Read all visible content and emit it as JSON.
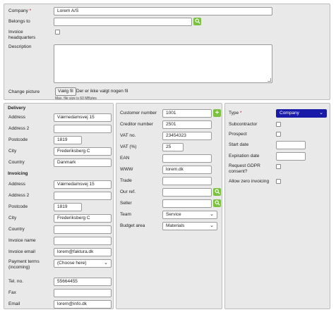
{
  "top": {
    "company_label": "Company",
    "required_mark": "*",
    "company_value": "Lorem A/S",
    "belongs_to_label": "Belongs to",
    "belongs_to_value": "",
    "invoice_hq_label": "Invoice headquarters",
    "description_label": "Description",
    "change_picture_label": "Change picture",
    "file_button_label": "Vælg fil",
    "file_status": "Der er ikke valgt nogen fil",
    "file_hint": "Max. file size is 60 MBytes"
  },
  "delivery": {
    "title": "Delivery",
    "address_label": "Address",
    "address_value": "Værnedamsvej 15",
    "address2_label": "Address 2",
    "address2_value": "",
    "postcode_label": "Postcode",
    "postcode_value": "1819",
    "city_label": "City",
    "city_value": "Frederiksberg C",
    "country_label": "Country",
    "country_value": "Danmark"
  },
  "invoicing": {
    "title": "Invoicing",
    "address_label": "Address",
    "address_value": "Værnedamsvej 15",
    "address2_label": "Address 2",
    "address2_value": "",
    "postcode_label": "Postcode",
    "postcode_value": "1819",
    "city_label": "City",
    "city_value": "Frederiksberg C",
    "country_label": "Country",
    "country_value": "",
    "invoice_name_label": "Invoice name",
    "invoice_name_value": "",
    "invoice_email_label": "Invoice email",
    "invoice_email_value": "lorem@faktura.dk",
    "payment_terms_label": "Payment terms (incoming)",
    "payment_terms_value": "(Choose here)",
    "tel_label": "Tel. no.",
    "tel_value": "55664455",
    "fax_label": "Fax",
    "fax_value": "",
    "email_label": "Email",
    "email_value": "lorem@info.dk"
  },
  "middle": {
    "customer_number_label": "Customer number",
    "customer_number_value": "1001",
    "creditor_number_label": "Creditor number",
    "creditor_number_value": "2501",
    "vat_no_label": "VAT no.",
    "vat_no_value": "23454323",
    "vat_pct_label": "VAT (%)",
    "vat_pct_value": "25",
    "ean_label": "EAN",
    "ean_value": "",
    "www_label": "WWW",
    "www_value": "lorem.dk",
    "trade_label": "Trade",
    "trade_value": "",
    "our_ref_label": "Our ref.",
    "our_ref_value": "",
    "seller_label": "Seller",
    "seller_value": "",
    "team_label": "Team",
    "team_value": "Service",
    "budget_area_label": "Budget area",
    "budget_area_value": "Materials"
  },
  "right": {
    "type_label": "Type",
    "type_value": "Company",
    "subcontractor_label": "Subcontractor",
    "prospect_label": "Prospect",
    "start_date_label": "Start date",
    "expiration_date_label": "Expiration date",
    "gdpr_label": "Request GDPR consent?",
    "allow_zero_label": "Allow zero invoicing"
  },
  "colors": {
    "accent_green": "#7ac142",
    "type_select_blue": "#1a1aa8",
    "required_red": "#d0021b",
    "panel_bg": "#e9e9e9"
  }
}
